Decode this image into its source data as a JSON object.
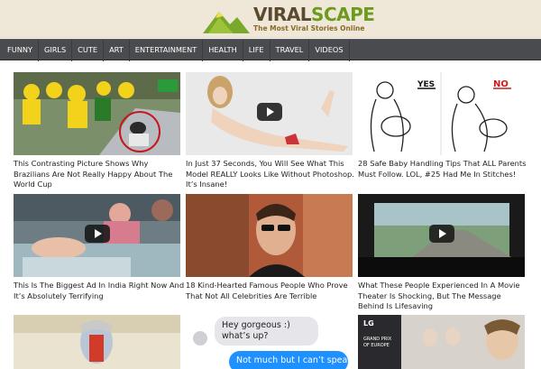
{
  "header": {
    "logo_name_part1": "VIRAL",
    "logo_name_part2": "SCAPE",
    "tagline": "The Most Viral Stories Online"
  },
  "nav": {
    "items": [
      "FUNNY",
      "GIRLS",
      "CUTE",
      "ART",
      "ENTERTAINMENT",
      "HEALTH",
      "LIFE",
      "TRAVEL",
      "VIDEOS"
    ]
  },
  "cards": [
    {
      "caption": "This Contrasting Picture Shows Why Brazilians Are Not Really Happy About The World Cup"
    },
    {
      "caption": "In Just 37 Seconds, You Will See What This Model REALLY Looks Like Without Photoshop. It’s Insane!"
    },
    {
      "caption": "28 Safe Baby Handling Tips That ALL Parents Must Follow. LOL, #25 Had Me In Stitches!"
    },
    {
      "caption": "This Is The Biggest Ad In India Right Now And It’s Absolutely Terrifying"
    },
    {
      "caption": "18 Kind-Hearted Famous People Who Prove That Not All Celebrities Are Terrible"
    },
    {
      "caption": "What These People Experienced In A Movie Theater Is Shocking, But The Message Behind Is Lifesaving"
    }
  ],
  "thumb_text": {
    "yes": "YES",
    "no": "NO",
    "chat_left": "Hey gorgeous :) what’s up?",
    "chat_right": "Not much but I can’t speak",
    "sign_lg": "LG",
    "sign_line1": "GRAND PRIX",
    "sign_line2": "OF EUROPE"
  },
  "colors": {
    "nav_background": "#4a4b4e",
    "header_background": "#efe7d8",
    "logo_green": "#6e9b1f",
    "chat_blue": "#1e90ff"
  }
}
